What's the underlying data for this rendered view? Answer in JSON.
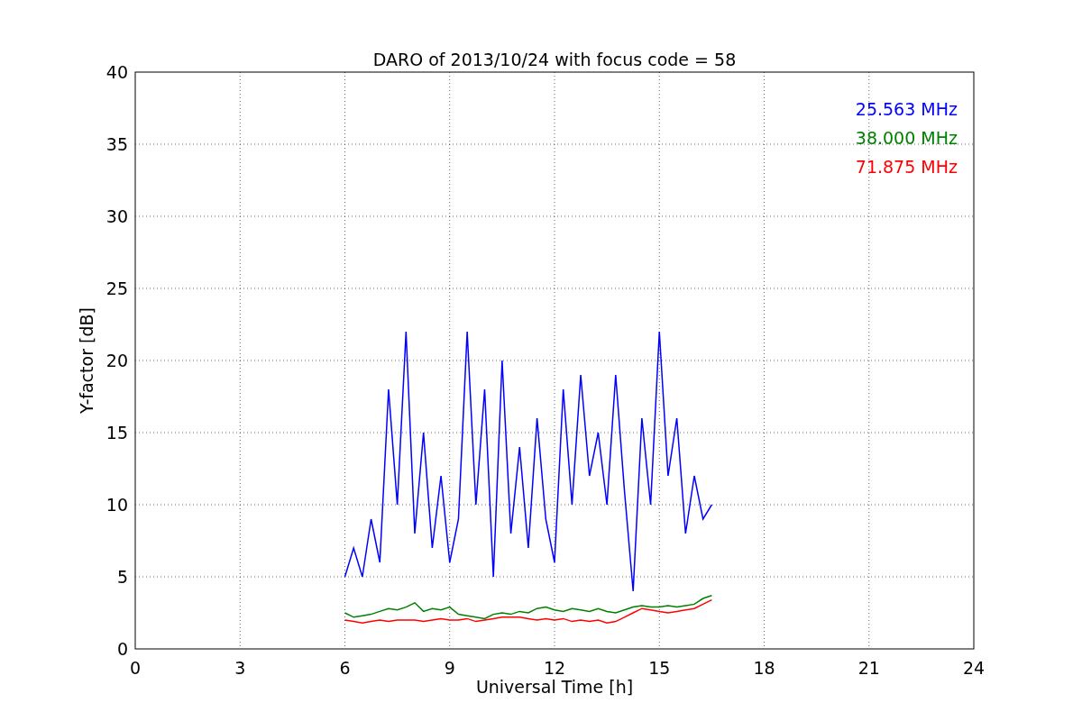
{
  "chart_data": {
    "type": "line",
    "title": "DARO of 2013/10/24 with focus code = 58",
    "xlabel": "Universal Time [h]",
    "ylabel": "Y-factor [dB]",
    "x": [
      6.0,
      6.25,
      6.5,
      6.75,
      7.0,
      7.25,
      7.5,
      7.75,
      8.0,
      8.25,
      8.5,
      8.75,
      9.0,
      9.25,
      9.5,
      9.75,
      10.0,
      10.25,
      10.5,
      10.75,
      11.0,
      11.25,
      11.5,
      11.75,
      12.0,
      12.25,
      12.5,
      12.75,
      13.0,
      13.25,
      13.5,
      13.75,
      14.0,
      14.25,
      14.5,
      14.75,
      15.0,
      15.25,
      15.5,
      15.75,
      16.0,
      16.25,
      16.5
    ],
    "series": [
      {
        "name": "25.563 MHz",
        "color": "#0000ff",
        "values": [
          5,
          7,
          5,
          9,
          6,
          18,
          10,
          22,
          8,
          15,
          7,
          12,
          6,
          9,
          22,
          10,
          18,
          5,
          20,
          8,
          14,
          7,
          16,
          9,
          6,
          18,
          10,
          19,
          12,
          15,
          10,
          19,
          11,
          4,
          16,
          10,
          22,
          12,
          16,
          8,
          12,
          9,
          10
        ]
      },
      {
        "name": "38.000 MHz",
        "color": "#008000",
        "values": [
          2.5,
          2.2,
          2.3,
          2.4,
          2.6,
          2.8,
          2.7,
          2.9,
          3.2,
          2.6,
          2.8,
          2.7,
          2.9,
          2.4,
          2.3,
          2.2,
          2.1,
          2.4,
          2.5,
          2.4,
          2.6,
          2.5,
          2.8,
          2.9,
          2.7,
          2.6,
          2.8,
          2.7,
          2.6,
          2.8,
          2.6,
          2.5,
          2.7,
          2.9,
          3.0,
          2.9,
          2.9,
          3.0,
          2.9,
          3.0,
          3.1,
          3.5,
          3.7
        ]
      },
      {
        "name": "71.875 MHz",
        "color": "#ff0000",
        "values": [
          2.0,
          1.9,
          1.8,
          1.9,
          2.0,
          1.9,
          2.0,
          2.0,
          2.0,
          1.9,
          2.0,
          2.1,
          2.0,
          2.0,
          2.1,
          1.9,
          2.0,
          2.1,
          2.2,
          2.2,
          2.2,
          2.1,
          2.0,
          2.1,
          2.0,
          2.1,
          1.9,
          2.0,
          1.9,
          2.0,
          1.8,
          1.9,
          2.2,
          2.5,
          2.8,
          2.7,
          2.6,
          2.5,
          2.6,
          2.7,
          2.8,
          3.1,
          3.4
        ]
      }
    ],
    "xlim": [
      0,
      24
    ],
    "ylim": [
      0,
      40
    ],
    "xticks": [
      0,
      3,
      6,
      9,
      12,
      15,
      18,
      21,
      24
    ],
    "yticks": [
      0,
      5,
      10,
      15,
      20,
      25,
      30,
      35,
      40
    ],
    "grid": true
  }
}
